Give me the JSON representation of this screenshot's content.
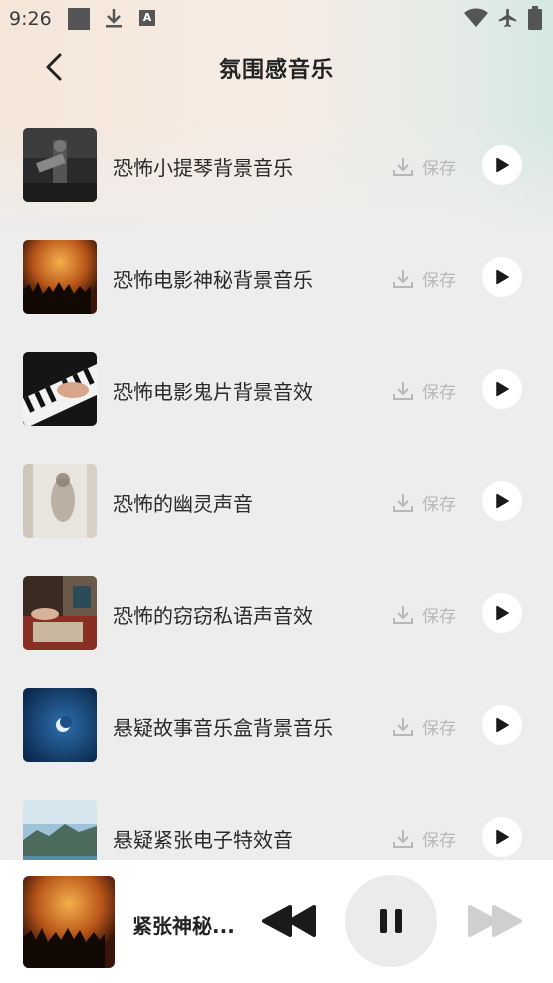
{
  "status_bar": {
    "time": "9:26",
    "notif_letter": "A"
  },
  "header": {
    "title": "氛围感音乐"
  },
  "save_label": "保存",
  "tracks": [
    {
      "title": "恐怖小提琴背景音乐"
    },
    {
      "title": "恐怖电影神秘背景音乐"
    },
    {
      "title": "恐怖电影鬼片背景音效"
    },
    {
      "title": "恐怖的幽灵声音"
    },
    {
      "title": "恐怖的窃窃私语声音效"
    },
    {
      "title": "悬疑故事音乐盒背景音乐"
    },
    {
      "title": "悬疑紧张电子特效音"
    }
  ],
  "player": {
    "now_playing": "紧张神秘..."
  },
  "colors": {
    "accent": "#1a1a1a",
    "save_gray": "#b8b8b8"
  }
}
